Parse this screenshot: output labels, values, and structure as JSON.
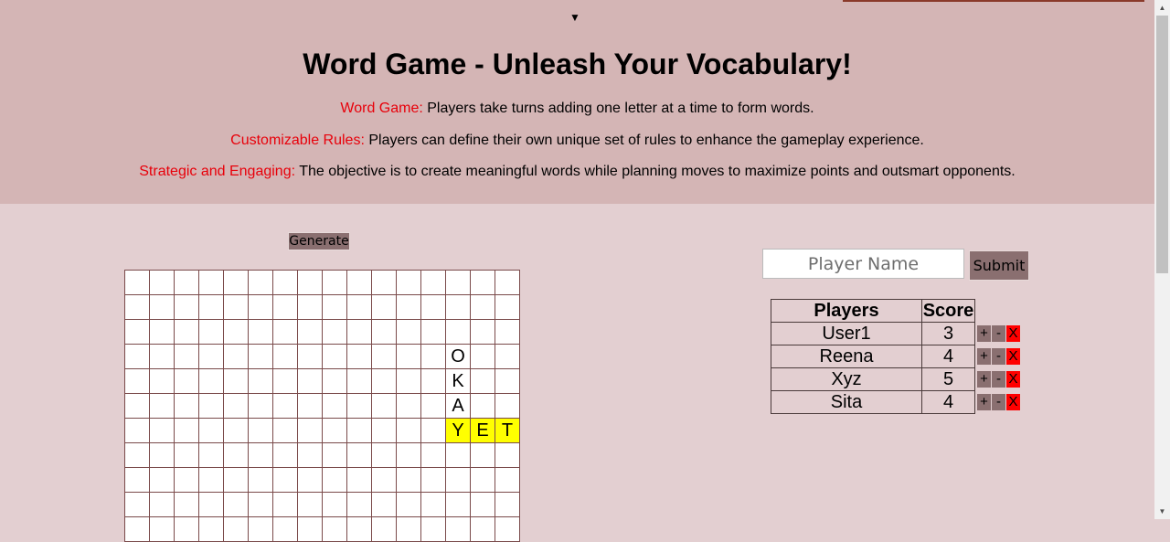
{
  "header": {
    "toggle_icon": "▼",
    "title": "Word Game - Unleash Your Vocabulary!",
    "features": [
      {
        "key": "Word Game:",
        "text": " Players take turns adding one letter at a time to form words."
      },
      {
        "key": "Customizable Rules:",
        "text": " Players can define their own unique set of rules to enhance the gameplay experience."
      },
      {
        "key": "Strategic and Engaging:",
        "text": " The objective is to create meaningful words while planning moves to maximize points and outsmart opponents."
      }
    ]
  },
  "board": {
    "generate_label": "Generate",
    "cols": 16,
    "visible_rows": 11,
    "cells": [
      {
        "row": 3,
        "col": 13,
        "letter": "O",
        "highlight": false
      },
      {
        "row": 4,
        "col": 13,
        "letter": "K",
        "highlight": false
      },
      {
        "row": 5,
        "col": 13,
        "letter": "A",
        "highlight": false
      },
      {
        "row": 6,
        "col": 13,
        "letter": "Y",
        "highlight": true
      },
      {
        "row": 6,
        "col": 14,
        "letter": "E",
        "highlight": true
      },
      {
        "row": 6,
        "col": 15,
        "letter": "T",
        "highlight": true
      }
    ],
    "highlight_color": "#ffff00"
  },
  "player_form": {
    "placeholder": "Player Name",
    "value": "",
    "submit_label": "Submit"
  },
  "scoreboard": {
    "headers": {
      "players": "Players",
      "score": "Score"
    },
    "rows": [
      {
        "name": "User1",
        "score": "3"
      },
      {
        "name": "Reena",
        "score": "4"
      },
      {
        "name": "Xyz",
        "score": "5"
      },
      {
        "name": "Sita",
        "score": "4"
      }
    ],
    "controls": {
      "plus": "+",
      "minus": "-",
      "delete": "X"
    }
  },
  "colors": {
    "header_bg": "#d4b5b5",
    "page_bg": "#e3cfd1",
    "feature_key": "#e8000a",
    "button_bg": "#8a6f70",
    "delete_bg": "#ff0000"
  },
  "scrollbar": {
    "up_icon": "▲",
    "down_icon": "▼"
  }
}
